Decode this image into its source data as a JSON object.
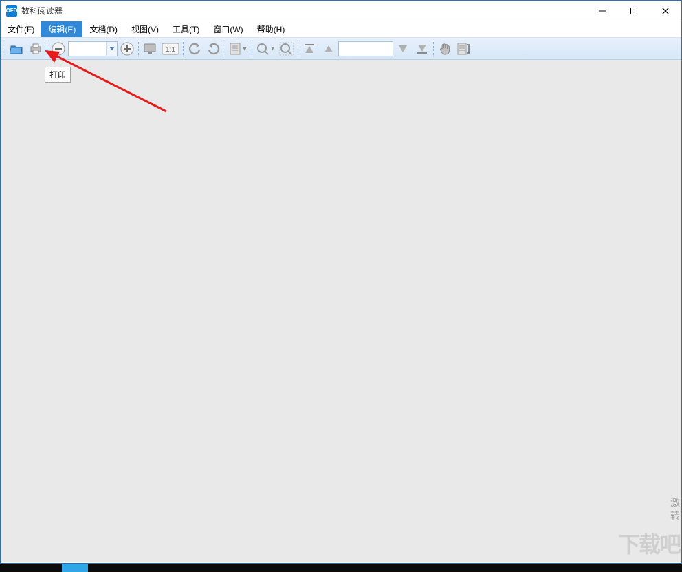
{
  "window": {
    "title": "数科阅读器",
    "icon_label": "OFD"
  },
  "menus": {
    "file": "文件(F)",
    "edit": "编辑(E)",
    "doc": "文档(D)",
    "view": "视图(V)",
    "tools": "工具(T)",
    "window": "窗口(W)",
    "help": "帮助(H)"
  },
  "toolbar": {
    "zoom_value": "",
    "fit_label": "1:1",
    "page_value": ""
  },
  "tooltip": {
    "print": "打印"
  },
  "watermark": {
    "line1": "激",
    "line2": "转",
    "brand": "下载吧"
  }
}
